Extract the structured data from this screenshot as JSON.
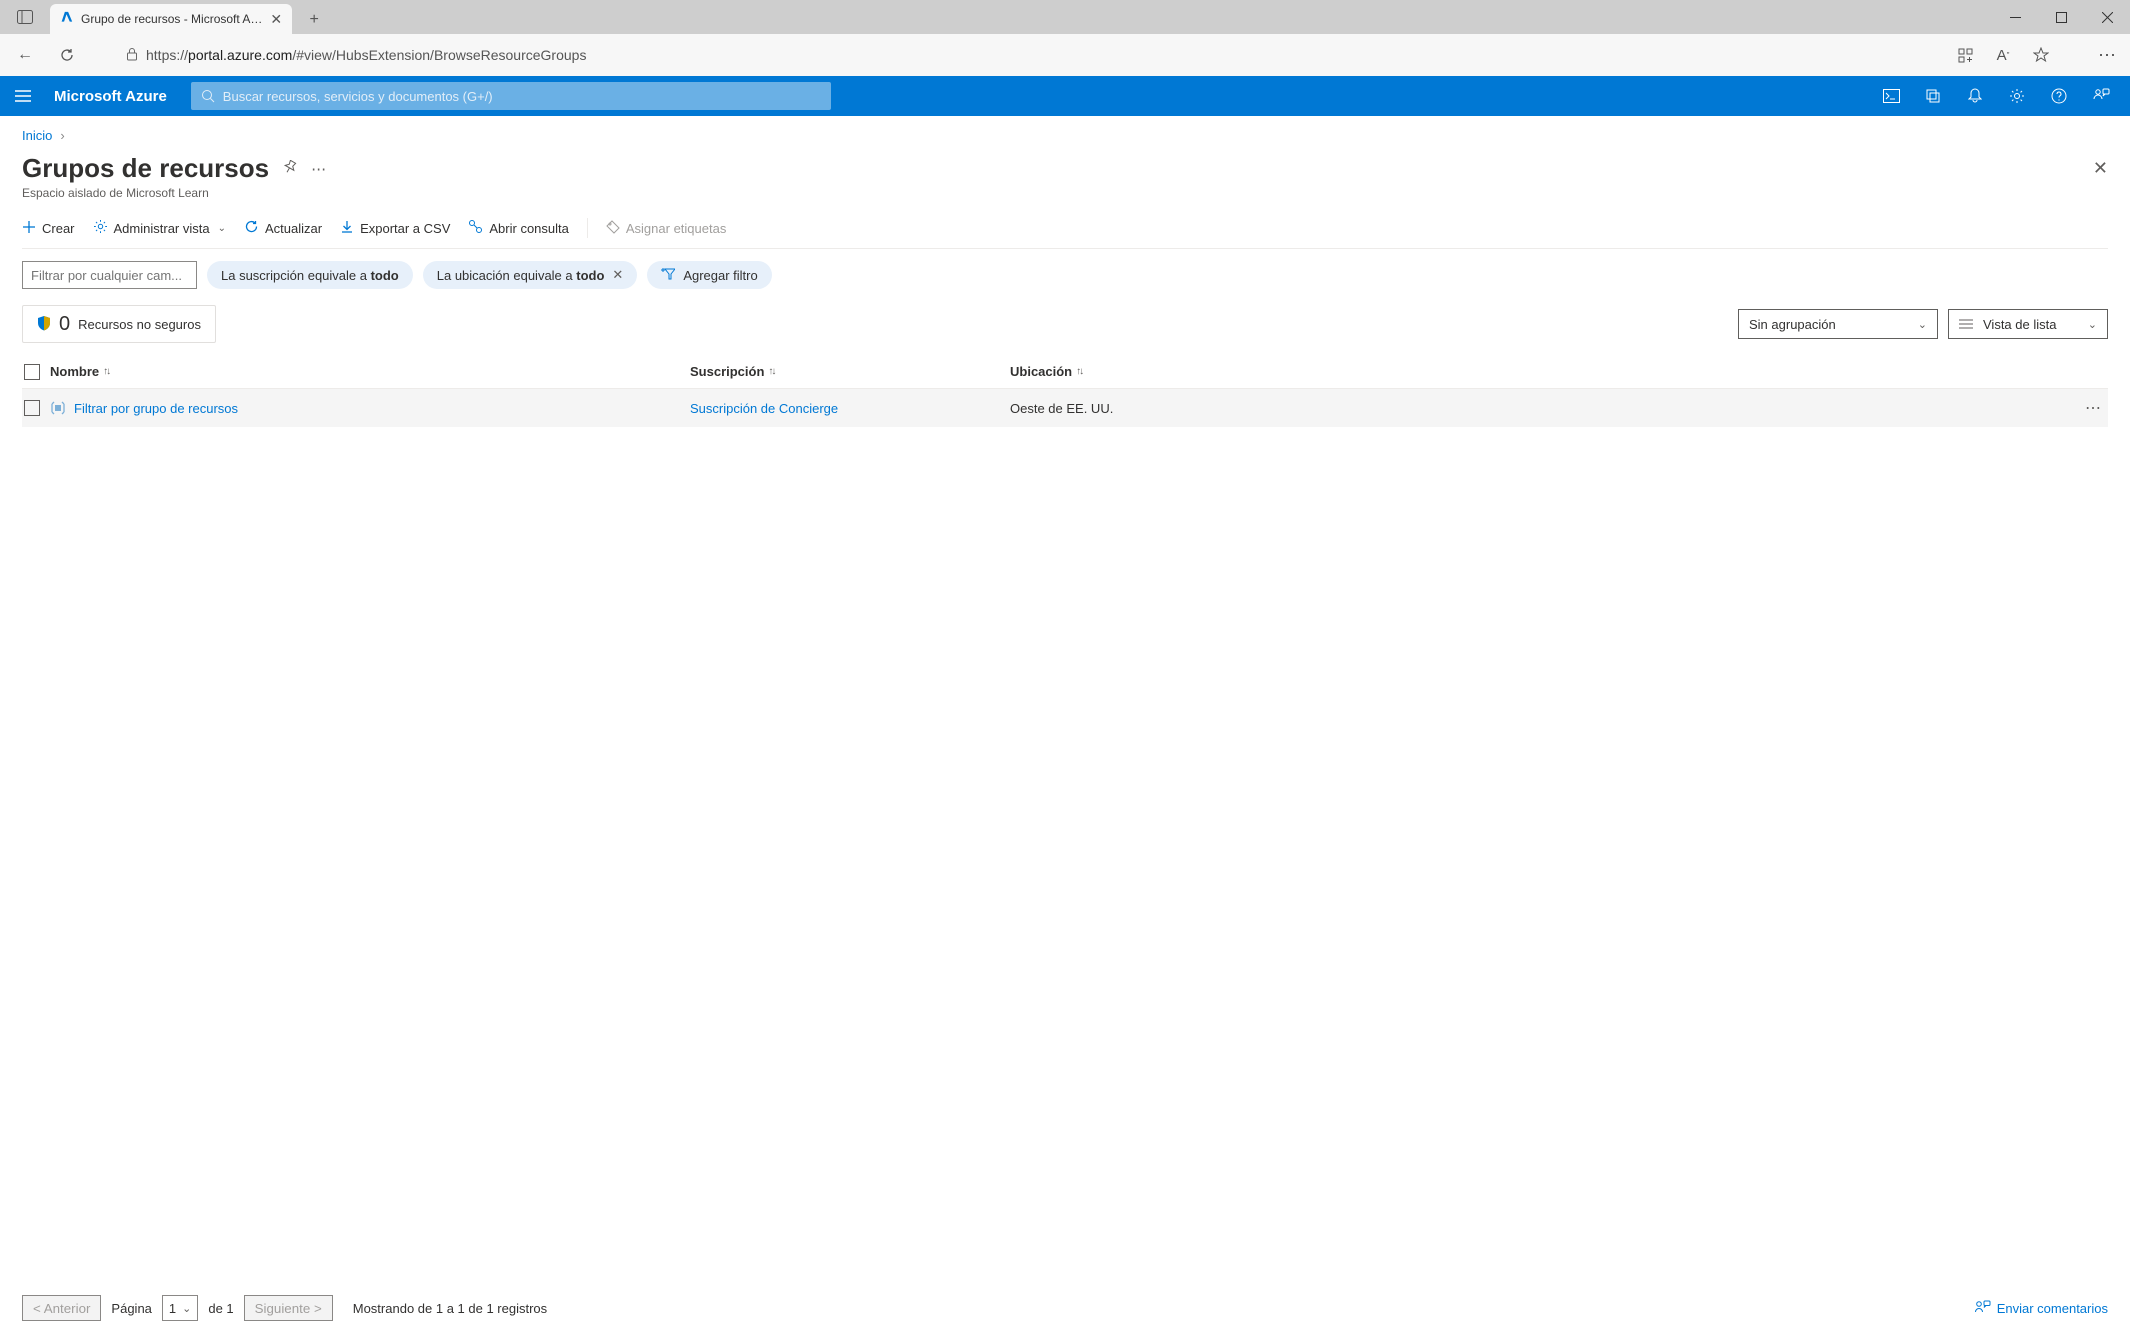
{
  "browser": {
    "tab_title": "Grupo de recursos - Microsoft A…",
    "url_prefix": "https://",
    "url_host": "portal.azure.com",
    "url_path": "/#view/HubsExtension/BrowseResourceGroups"
  },
  "azure": {
    "brand": "Microsoft Azure",
    "search_placeholder": "Buscar recursos, servicios y documentos (G+/)"
  },
  "breadcrumb": {
    "home": "Inicio"
  },
  "page": {
    "title": "Grupos de recursos",
    "subtitle": "Espacio aislado de Microsoft Learn"
  },
  "toolbar": {
    "create": "Crear",
    "manage_view": "Administrar vista",
    "refresh": "Actualizar",
    "export_csv": "Exportar a CSV",
    "open_query": "Abrir consulta",
    "assign_tags": "Asignar etiquetas"
  },
  "filters": {
    "input_placeholder": "Filtrar por cualquier cam...",
    "subscription_prefix": "La suscripción equivale a ",
    "subscription_value": "todo",
    "location_prefix": "La ubicación equivale a ",
    "location_value": "todo",
    "add_filter": "Agregar filtro"
  },
  "insecure": {
    "count": "0",
    "label": "Recursos no seguros"
  },
  "dropdowns": {
    "grouping": "Sin agrupación",
    "view_list": "Vista de lista"
  },
  "table": {
    "headers": {
      "name": "Nombre",
      "subscription": "Suscripción",
      "location": "Ubicación"
    },
    "rows": [
      {
        "name": "Filtrar por grupo de recursos",
        "subscription": "Suscripción de Concierge",
        "location": "Oeste de EE. UU."
      }
    ]
  },
  "pager": {
    "prev": "< Anterior",
    "page_label": "Página",
    "page_value": "1",
    "of": "de 1",
    "next": "Siguiente >",
    "showing": "Mostrando de 1 a 1 de 1 registros"
  },
  "feedback": "Enviar comentarios"
}
